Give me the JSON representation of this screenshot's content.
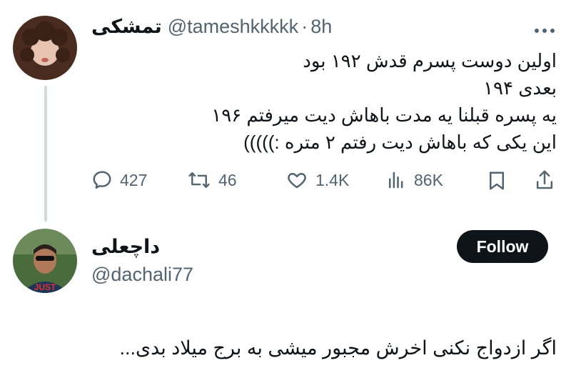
{
  "tweet": {
    "display_name": "تمشکی",
    "handle": "@tameshkkkkk",
    "separator": "·",
    "time": "8h",
    "more_icon": "more-dots-icon",
    "text": "اولین دوست پسرم قدش ۱۹۲ بود\nبعدی ۱۹۴\nیه پسره قبلنا یه مدت باهاش دیت میرفتم ۱۹۶\nاین یکی که باهاش دیت رفتم ۲ متره :)))))",
    "actions": {
      "replies": "427",
      "retweets": "46",
      "likes": "1.4K",
      "views": "86K"
    }
  },
  "reply_user": {
    "display_name": "داچعلی",
    "handle": "@dachali77",
    "follow_label": "Follow"
  },
  "reply": {
    "text": "اگر ازدواج نکنی اخرش مجبور میشی به برج میلاد بدی..."
  },
  "colors": {
    "text": "#0f1419",
    "secondary": "#536471",
    "thread_line": "#cfd9de",
    "button": "#0f1419"
  }
}
